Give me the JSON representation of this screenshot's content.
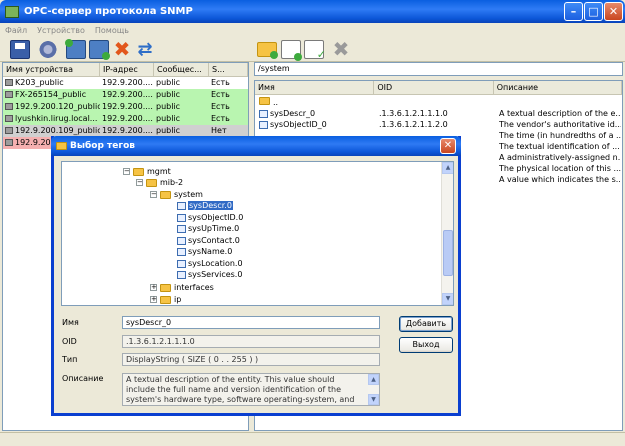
{
  "window": {
    "title": "OPC-сервер протокола SNMP",
    "minimize_glyph": "–",
    "maximize_glyph": "□",
    "close_glyph": "✕"
  },
  "menu": [
    "Файл",
    "Устройство",
    "Помощь"
  ],
  "toolbar": {
    "left_icons": [
      "save-icon",
      "settings-icon",
      "add-device-icon",
      "edit-device-icon",
      "delete-icon",
      "refresh-icon"
    ],
    "right_icons": [
      "add-folder-icon",
      "add-tag-icon",
      "edit-tag-icon",
      "delete-tag-icon"
    ]
  },
  "devices": {
    "columns": [
      "Имя устройства",
      "IP-адрес",
      "Сообщес...",
      "S..."
    ],
    "rows": [
      {
        "name": "K203_public",
        "ip": "192.9.200....",
        "community": "public",
        "status": "Есть",
        "color": "#FFFFFF"
      },
      {
        "name": "FX-265154_public",
        "ip": "192.9.200....",
        "community": "public",
        "status": "Есть",
        "color": "#B9F5B0"
      },
      {
        "name": "192.9.200.120_public",
        "ip": "192.9.200....",
        "community": "public",
        "status": "Есть",
        "color": "#B9F5B0"
      },
      {
        "name": "lyushkin.lirug.local...",
        "ip": "192.9.200....",
        "community": "public",
        "status": "Есть",
        "color": "#B9F5B0"
      },
      {
        "name": "192.9.200.109_public",
        "ip": "192.9.200....",
        "community": "public",
        "status": "Нет",
        "color": "#D0D0D0"
      },
      {
        "name": "192.9.200",
        "ip": "",
        "community": "",
        "status": "",
        "color": "#F5B0B0"
      }
    ]
  },
  "tags": {
    "path": "/system",
    "columns": [
      "Имя",
      "OID",
      "Описание"
    ],
    "up_label": "..",
    "rows": [
      {
        "name": "sysDescr_0",
        "oid": ".1.3.6.1.2.1.1.1.0",
        "desc": "A textual description of the e..."
      },
      {
        "name": "sysObjectID_0",
        "oid": ".1.3.6.1.2.1.1.2.0",
        "desc": "The vendor's authoritative id..."
      },
      {
        "name": "",
        "oid": "",
        "desc": "The time (in hundredths of a ..."
      },
      {
        "name": "",
        "oid": "",
        "desc": "The textual identification of ..."
      },
      {
        "name": "",
        "oid": "",
        "desc": "A administratively-assigned n..."
      },
      {
        "name": "",
        "oid": "",
        "desc": "The physical location of this ..."
      },
      {
        "name": "",
        "oid": "",
        "desc": "A value which indicates the s..."
      }
    ]
  },
  "dialog": {
    "title": "Выбор тегов",
    "close_glyph": "✕",
    "tree": {
      "mgmt": "mgmt",
      "mib2": "mib-2",
      "system": "system",
      "leaves": [
        "sysDescr.0",
        "sysObjectID.0",
        "sysUpTime.0",
        "sysContact.0",
        "sysName.0",
        "sysLocation.0",
        "sysServices.0"
      ],
      "interfaces": "interfaces",
      "ip": "ip"
    },
    "fields": {
      "name_label": "Имя",
      "name_value": "sysDescr_0",
      "oid_label": "OID",
      "oid_value": ".1.3.6.1.2.1.1.1.0",
      "type_label": "Тип",
      "type_value": "DisplayString ( SIZE ( 0 . . 255 ) )",
      "desc_label": "Описание",
      "desc_value": "A textual description of the entity. This value should include the full name and version identification of the system's hardware type, software operating-system, and networking software. It is"
    },
    "buttons": {
      "add": "Добавить",
      "exit": "Выход"
    }
  }
}
